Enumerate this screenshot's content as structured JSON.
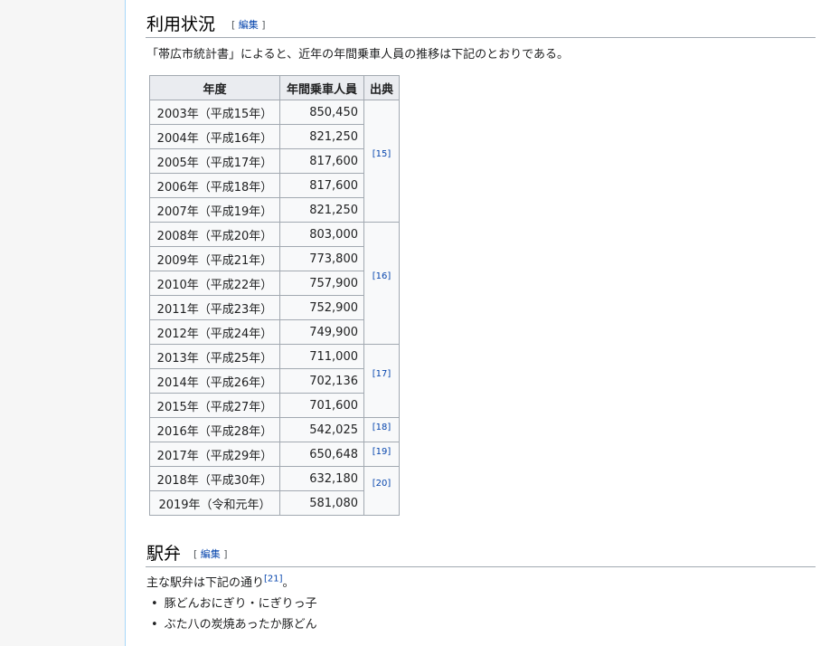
{
  "usage_section": {
    "title": "利用状況",
    "edit_label": "編集",
    "intro": "「帯広市統計書」によると、近年の年間乗車人員の推移は下記のとおりである。",
    "table": {
      "headers": [
        "年度",
        "年間乗車人員",
        "出典"
      ],
      "rows": [
        {
          "year": "2003年（平成15年）",
          "passengers": "850,450"
        },
        {
          "year": "2004年（平成16年）",
          "passengers": "821,250"
        },
        {
          "year": "2005年（平成17年）",
          "passengers": "817,600"
        },
        {
          "year": "2006年（平成18年）",
          "passengers": "817,600"
        },
        {
          "year": "2007年（平成19年）",
          "passengers": "821,250"
        },
        {
          "year": "2008年（平成20年）",
          "passengers": "803,000"
        },
        {
          "year": "2009年（平成21年）",
          "passengers": "773,800"
        },
        {
          "year": "2010年（平成22年）",
          "passengers": "757,900"
        },
        {
          "year": "2011年（平成23年）",
          "passengers": "752,900"
        },
        {
          "year": "2012年（平成24年）",
          "passengers": "749,900"
        },
        {
          "year": "2013年（平成25年）",
          "passengers": "711,000"
        },
        {
          "year": "2014年（平成26年）",
          "passengers": "702,136"
        },
        {
          "year": "2015年（平成27年）",
          "passengers": "701,600"
        },
        {
          "year": "2016年（平成28年）",
          "passengers": "542,025"
        },
        {
          "year": "2017年（平成29年）",
          "passengers": "650,648"
        },
        {
          "year": "2018年（平成30年）",
          "passengers": "632,180"
        },
        {
          "year": "2019年（令和元年）",
          "passengers": "581,080"
        }
      ],
      "sources": [
        {
          "label": "[15]",
          "span": 5
        },
        {
          "label": "[16]",
          "span": 5
        },
        {
          "label": "[17]",
          "span": 3
        },
        {
          "label": "[18]",
          "span": 1
        },
        {
          "label": "[19]",
          "span": 1
        },
        {
          "label": "[20]",
          "span": 2
        }
      ]
    }
  },
  "bento_section": {
    "title": "駅弁",
    "edit_label": "編集",
    "intro": "主な駅弁は下記の通り",
    "intro_ref": "[21]",
    "intro_end": "。",
    "items": [
      "豚どんおにぎり・にぎりっ子",
      "ぶた八の炭焼あったか豚どん"
    ]
  },
  "colors": {
    "link": "#0645ad",
    "header_bg": "#eaecf0",
    "border": "#a2a9b1"
  }
}
